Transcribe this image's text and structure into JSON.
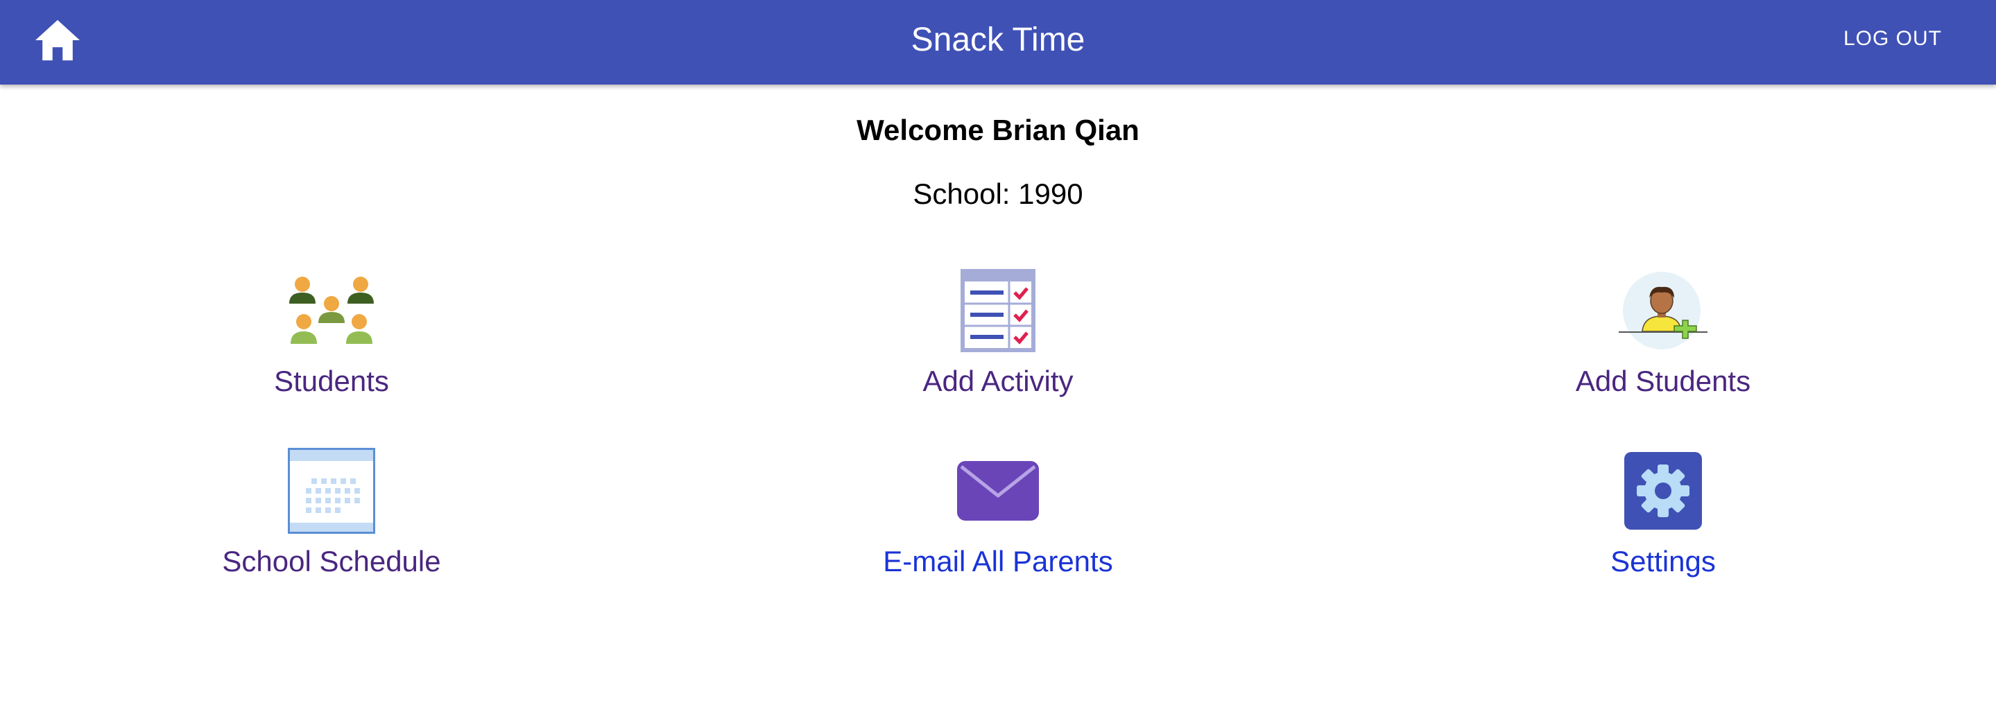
{
  "header": {
    "title": "Snack Time",
    "logout_label": "LOG OUT",
    "home_icon": "home-icon",
    "background_color": "#3f51b5"
  },
  "welcome": {
    "greeting": "Welcome Brian Qian",
    "school": "School: 1990"
  },
  "tiles": [
    {
      "label": "Students",
      "icon": "students-icon",
      "color": "#4a2680"
    },
    {
      "label": "Add Activity",
      "icon": "checklist-icon",
      "color": "#4a2680"
    },
    {
      "label": "Add Students",
      "icon": "add-student-icon",
      "color": "#4a2680"
    },
    {
      "label": "School Schedule",
      "icon": "calendar-icon",
      "color": "#4a2680"
    },
    {
      "label": "E-mail All Parents",
      "icon": "envelope-icon",
      "color": "#1a33d6"
    },
    {
      "label": "Settings",
      "icon": "gear-icon",
      "color": "#1a33d6"
    }
  ]
}
